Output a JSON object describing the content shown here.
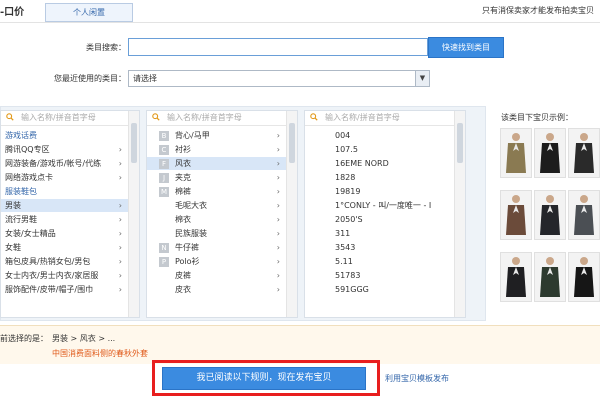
{
  "header": {
    "title": "-口价",
    "tab_label": "个人闲置",
    "notice": "只有消保卖家才能发布拍卖宝贝"
  },
  "form": {
    "search_label": "类目搜索：",
    "search_value": "",
    "search_button": "快速找到类目",
    "recent_label": "您最近使用的类目：",
    "recent_select": "请选择"
  },
  "columns": {
    "search_placeholder": "输入名称/拼音首字母",
    "col1": [
      {
        "label": "游戏话费",
        "group": true
      },
      {
        "label": "腾讯QQ专区"
      },
      {
        "label": "网游装备/游戏币/帐号/代练"
      },
      {
        "label": "网络游戏点卡"
      },
      {
        "label": "服装鞋包",
        "group": true
      },
      {
        "label": "男装",
        "selected": true
      },
      {
        "label": "流行男鞋"
      },
      {
        "label": "女装/女士精品"
      },
      {
        "label": "女鞋"
      },
      {
        "label": "箱包皮具/热销女包/男包"
      },
      {
        "label": "女士内衣/男士内衣/家居服"
      },
      {
        "label": "服饰配件/皮带/帽子/围巾"
      }
    ],
    "col2": [
      {
        "letter": "B",
        "label": "背心/马甲"
      },
      {
        "letter": "C",
        "label": "衬衫"
      },
      {
        "letter": "F",
        "label": "风衣",
        "selected": true
      },
      {
        "letter": "J",
        "label": "夹克"
      },
      {
        "letter": "M",
        "label": "棉裤"
      },
      {
        "letter": "",
        "label": "毛呢大衣"
      },
      {
        "letter": "",
        "label": "棉衣"
      },
      {
        "letter": "",
        "label": "民族服装"
      },
      {
        "letter": "N",
        "label": "牛仔裤"
      },
      {
        "letter": "P",
        "label": "Polo衫"
      },
      {
        "letter": "",
        "label": "皮裤"
      },
      {
        "letter": "",
        "label": "皮衣"
      }
    ],
    "col3": [
      "004",
      "107.5",
      "16EME NORD",
      "1828",
      "19819",
      "1°CONLY - 叫/一度唯一 - I",
      "2050'S",
      "311",
      "3543",
      "5.11",
      "51783",
      "591GGG"
    ]
  },
  "examples": {
    "title": "该类目下宝贝示例：",
    "images": [
      "coat-khaki",
      "coat-black",
      "coat-black-2",
      "jacket-plaid",
      "jacket-dark",
      "coat-gray",
      "coat-black-3",
      "coat-dark-green",
      "coat-black-4"
    ]
  },
  "current": {
    "label": "前选择的是：",
    "path": "男装 > 风衣 > ...",
    "note": "中国消费面料侧的春秋外套"
  },
  "actions": {
    "publish_button": "我已阅读以下规则，现在发布宝贝",
    "template_link": "利用宝贝模板发布"
  },
  "colors": {
    "accent": "#3b8be0",
    "highlight": "#e81e1e"
  }
}
